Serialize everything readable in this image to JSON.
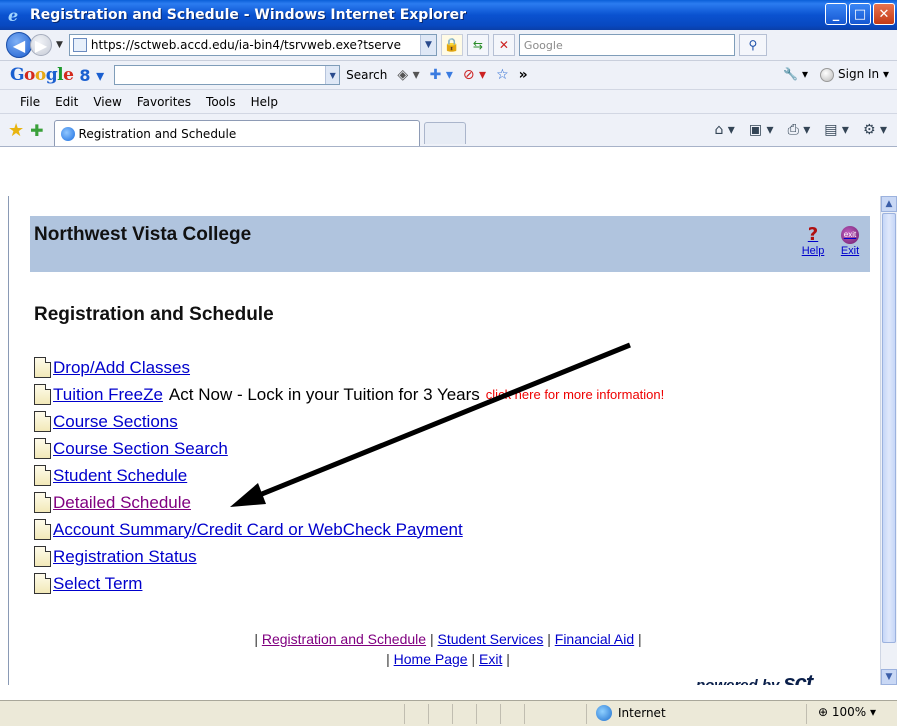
{
  "window": {
    "title": "Registration and Schedule - Windows Internet Explorer",
    "buttons": [
      "_",
      "□",
      "X"
    ]
  },
  "address_bar": {
    "url": "https://sctweb.accd.edu/ia-bin4/tsrvweb.exe?tserve",
    "search_placeholder": "Google"
  },
  "google_toolbar": {
    "logo": "Google",
    "menu_badge": "8",
    "search_button": "Search",
    "more": "»",
    "sign_in": "Sign In"
  },
  "menu_bar": {
    "items": [
      "File",
      "Edit",
      "View",
      "Favorites",
      "Tools",
      "Help"
    ]
  },
  "tab": {
    "label": "Registration and Schedule"
  },
  "page": {
    "college_name": "Northwest Vista College",
    "help_label": "Help",
    "exit_label": "Exit",
    "section_title": "Registration and Schedule",
    "links": [
      {
        "label": "Drop/Add Classes",
        "visited": false
      },
      {
        "label": "Tuition FreeZe",
        "visited": false,
        "note": "Act Now - Lock in your Tuition for 3 Years",
        "extra_link": "click here for more information!"
      },
      {
        "label": "Course Sections",
        "visited": false
      },
      {
        "label": "Course Section Search",
        "visited": false
      },
      {
        "label": "Student Schedule",
        "visited": false
      },
      {
        "label": "Detailed Schedule",
        "visited": true
      },
      {
        "label": "Account Summary/Credit Card or WebCheck Payment",
        "visited": false
      },
      {
        "label": "Registration Status",
        "visited": false
      },
      {
        "label": "Select Term",
        "visited": false
      }
    ],
    "footer": {
      "line1": [
        "Registration and Schedule",
        "Student Services",
        "Financial Aid"
      ],
      "line2": [
        "Home Page",
        "Exit"
      ]
    },
    "powered_by": "powered by",
    "powered_brand": "sct"
  },
  "status_bar": {
    "zone": "Internet",
    "zoom": "100%"
  }
}
